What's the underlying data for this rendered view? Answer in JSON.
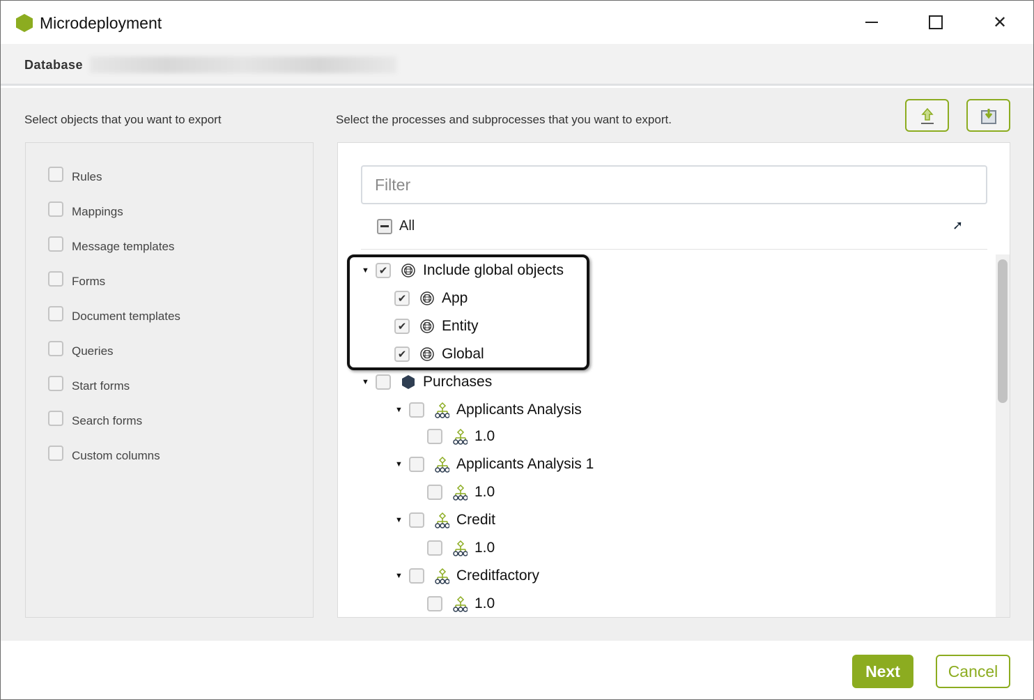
{
  "window": {
    "title": "Microdeployment",
    "brand_color": "#8cac20"
  },
  "header": {
    "label": "Database"
  },
  "left": {
    "instruction": "Select objects that you want to export",
    "items": [
      {
        "label": "Rules",
        "checked": false
      },
      {
        "label": "Mappings",
        "checked": false
      },
      {
        "label": "Message templates",
        "checked": false
      },
      {
        "label": "Forms",
        "checked": false
      },
      {
        "label": "Document templates",
        "checked": false
      },
      {
        "label": "Queries",
        "checked": false
      },
      {
        "label": "Start forms",
        "checked": false
      },
      {
        "label": "Search forms",
        "checked": false
      },
      {
        "label": "Custom columns",
        "checked": false
      }
    ]
  },
  "right": {
    "instruction": "Select the processes and subprocesses that you want to export.",
    "filter_placeholder": "Filter",
    "all_label": "All",
    "tree": [
      {
        "label": "Include global objects",
        "level": 0,
        "checked": true,
        "expander": true,
        "icon": "global-icon"
      },
      {
        "label": "App",
        "level": 1,
        "checked": true,
        "expander": false,
        "icon": "global-icon"
      },
      {
        "label": "Entity",
        "level": 1,
        "checked": true,
        "expander": false,
        "icon": "global-icon"
      },
      {
        "label": "Global",
        "level": 1,
        "checked": true,
        "expander": false,
        "icon": "global-icon"
      },
      {
        "label": "Purchases",
        "level": 0,
        "checked": false,
        "expander": true,
        "icon": "application-icon"
      },
      {
        "label": "Applicants Analysis",
        "level": 2,
        "checked": false,
        "expander": true,
        "icon": "process-icon"
      },
      {
        "label": "1.0",
        "level": 3,
        "checked": false,
        "expander": false,
        "icon": "process-icon"
      },
      {
        "label": "Applicants Analysis 1",
        "level": 2,
        "checked": false,
        "expander": true,
        "icon": "process-icon"
      },
      {
        "label": "1.0",
        "level": 3,
        "checked": false,
        "expander": false,
        "icon": "process-icon"
      },
      {
        "label": "Credit",
        "level": 2,
        "checked": false,
        "expander": true,
        "icon": "process-icon"
      },
      {
        "label": "1.0",
        "level": 3,
        "checked": false,
        "expander": false,
        "icon": "process-icon"
      },
      {
        "label": "Creditfactory",
        "level": 2,
        "checked": false,
        "expander": true,
        "icon": "process-icon"
      },
      {
        "label": "1.0",
        "level": 3,
        "checked": false,
        "expander": false,
        "icon": "process-icon"
      }
    ]
  },
  "footer": {
    "next": "Next",
    "cancel": "Cancel"
  }
}
